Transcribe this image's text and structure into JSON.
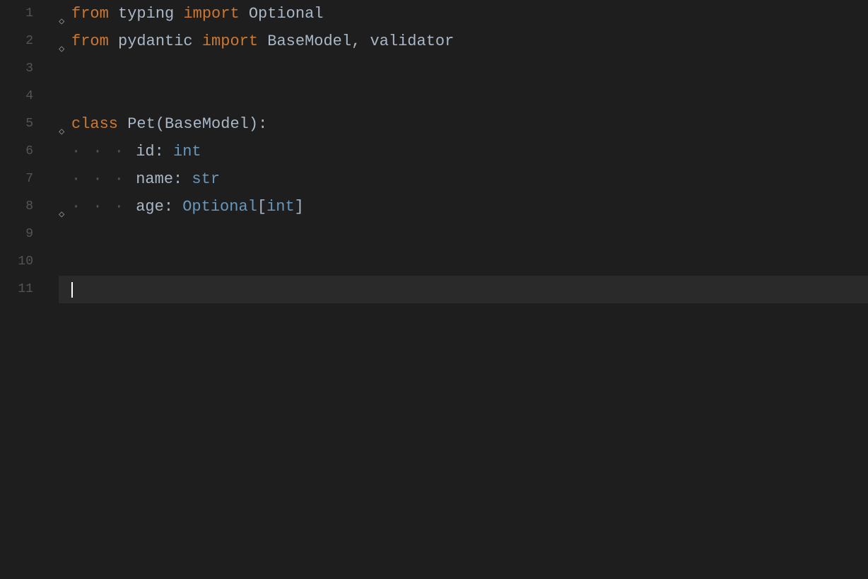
{
  "editor": {
    "background": "#1e1e1e",
    "lines": [
      {
        "number": 1,
        "foldable": true,
        "tokens": [
          {
            "text": "from",
            "class": "kw-from"
          },
          {
            "text": " typing ",
            "class": "identifier"
          },
          {
            "text": "import",
            "class": "kw-import"
          },
          {
            "text": " Optional",
            "class": "identifier"
          }
        ]
      },
      {
        "number": 2,
        "foldable": true,
        "tokens": [
          {
            "text": "from",
            "class": "kw-from"
          },
          {
            "text": " pydantic ",
            "class": "identifier"
          },
          {
            "text": "import",
            "class": "kw-import"
          },
          {
            "text": " BaseModel",
            "class": "identifier"
          },
          {
            "text": ",",
            "class": "punct"
          },
          {
            "text": " validator",
            "class": "identifier"
          }
        ]
      },
      {
        "number": 3,
        "foldable": false,
        "tokens": []
      },
      {
        "number": 4,
        "foldable": false,
        "tokens": []
      },
      {
        "number": 5,
        "foldable": true,
        "tokens": [
          {
            "text": "class",
            "class": "kw-class"
          },
          {
            "text": " Pet",
            "class": "cls-name"
          },
          {
            "text": "(BaseModel)",
            "class": "identifier"
          },
          {
            "text": ":",
            "class": "colon"
          }
        ]
      },
      {
        "number": 6,
        "foldable": false,
        "indent": "dots4",
        "tokens": [
          {
            "text": "id",
            "class": "identifier"
          },
          {
            "text": ":",
            "class": "colon"
          },
          {
            "text": " int",
            "class": "type-builtin"
          }
        ]
      },
      {
        "number": 7,
        "foldable": false,
        "indent": "dots4",
        "tokens": [
          {
            "text": "name",
            "class": "identifier"
          },
          {
            "text": ":",
            "class": "colon"
          },
          {
            "text": " str",
            "class": "type-builtin"
          }
        ]
      },
      {
        "number": 8,
        "foldable": true,
        "indent": "dots4",
        "tokens": [
          {
            "text": "age",
            "class": "identifier"
          },
          {
            "text": ":",
            "class": "colon"
          },
          {
            "text": " Optional",
            "class": "type-optional"
          },
          {
            "text": "[",
            "class": "bracket"
          },
          {
            "text": "int",
            "class": "type-builtin"
          },
          {
            "text": "]",
            "class": "bracket"
          }
        ]
      },
      {
        "number": 9,
        "foldable": false,
        "tokens": []
      },
      {
        "number": 10,
        "foldable": false,
        "tokens": []
      },
      {
        "number": 11,
        "foldable": false,
        "active": true,
        "tokens": []
      }
    ]
  }
}
